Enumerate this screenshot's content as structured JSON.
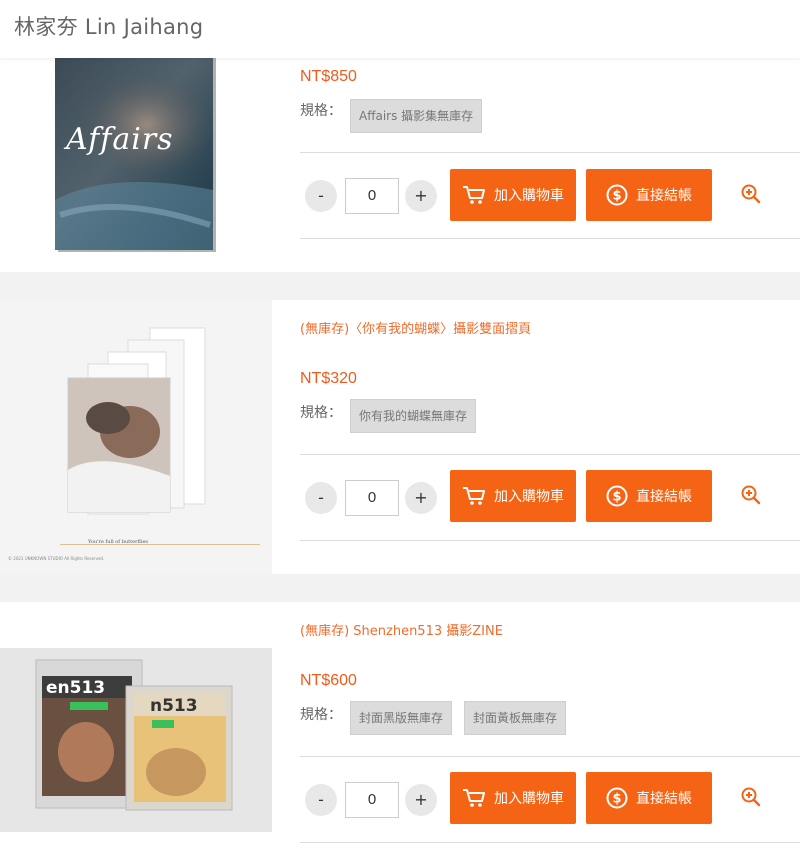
{
  "site": {
    "title": "林家夯 Lin Jaihang"
  },
  "labels": {
    "spec": "規格：",
    "add_to_cart": "加入購物車",
    "checkout": "直接結帳",
    "minus": "-",
    "plus": "+"
  },
  "products": [
    {
      "name": "",
      "price": "NT$850",
      "options": [
        "Affairs 攝影集無庫存"
      ],
      "qty": "0",
      "image_text": [
        "Affairs"
      ]
    },
    {
      "name": "(無庫存)〈你有我的蝴蝶〉攝影雙面摺頁",
      "price": "NT$320",
      "options": [
        "你有我的蝴蝶無庫存"
      ],
      "qty": "0"
    },
    {
      "name": "(無庫存) Shenzhen513 攝影ZINE",
      "price": "NT$600",
      "options": [
        "封面黑版無庫存",
        "封面黃板無庫存"
      ],
      "qty": "0",
      "image_text": [
        "en513",
        "n513"
      ]
    }
  ],
  "colors": {
    "accent": "#f46414",
    "price": "#f05a1a",
    "name": "#ef6c2c"
  },
  "icons": {
    "cart": "cart-icon",
    "dollar": "dollar-icon",
    "zoom": "zoom-in-icon"
  }
}
